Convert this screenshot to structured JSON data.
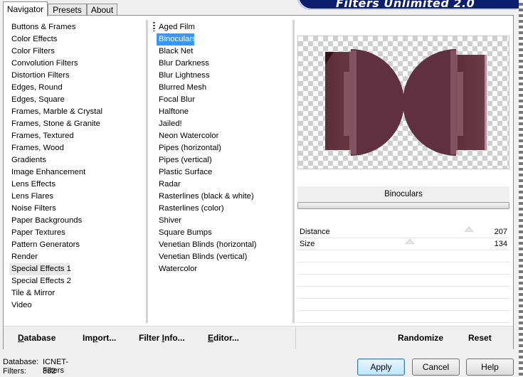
{
  "app": {
    "banner_title": "Filters Unlimited 2.0"
  },
  "tabs": [
    {
      "label": "Navigator",
      "active": true
    },
    {
      "label": "Presets",
      "active": false
    },
    {
      "label": "About",
      "active": false
    }
  ],
  "categories": [
    "Buttons & Frames",
    "Color Effects",
    "Color Filters",
    "Convolution Filters",
    "Distortion Filters",
    "Edges, Round",
    "Edges, Square",
    "Frames, Marble & Crystal",
    "Frames, Stone & Granite",
    "Frames, Textured",
    "Frames, Wood",
    "Gradients",
    "Image Enhancement",
    "Lens Effects",
    "Lens Flares",
    "Noise Filters",
    "Paper Backgrounds",
    "Paper Textures",
    "Pattern Generators",
    "Render",
    "Special Effects 1",
    "Special Effects 2",
    "Tile & Mirror",
    "Video"
  ],
  "selected_category": "Special Effects 1",
  "filters": [
    "Aged Film",
    "Binoculars",
    "Black Net",
    "Blur Darkness",
    "Blur Lightness",
    "Blurred Mesh",
    "Focal Blur",
    "Halftone",
    "Jailed!",
    "Neon Watercolor",
    "Pipes (horizontal)",
    "Pipes (vertical)",
    "Plastic Surface",
    "Radar",
    "Rasterlines (black & white)",
    "Rasterlines (color)",
    "Shiver",
    "Square Bumps",
    "Venetian Blinds (horizontal)",
    "Venetian Blinds (vertical)",
    "Watercolor"
  ],
  "selected_filter": "Binoculars",
  "filter_title": "Binoculars",
  "params": [
    {
      "label": "Distance",
      "value": "207",
      "fraction": 0.81
    },
    {
      "label": "Size",
      "value": "134",
      "fraction": 0.53
    }
  ],
  "toolbar": {
    "database": {
      "accel": "D",
      "rest": "atabase"
    },
    "import": {
      "pre": "Im",
      "accel": "p",
      "rest": "ort..."
    },
    "filter_info": {
      "pre": "Filter ",
      "accel": "I",
      "rest": "nfo..."
    },
    "editor": {
      "accel": "E",
      "rest": "ditor..."
    },
    "randomize": "Randomize",
    "reset": "Reset"
  },
  "status": {
    "database_label": "Database:",
    "database_value": "ICNET-Filters",
    "filters_label": "Filters:",
    "filters_value": "382"
  },
  "buttons": {
    "apply": "Apply",
    "cancel": "Cancel",
    "help": "Help"
  },
  "colors": {
    "selection": "#3399ff",
    "banner": "#0d1e6e",
    "lens": "#5e2f3c"
  }
}
